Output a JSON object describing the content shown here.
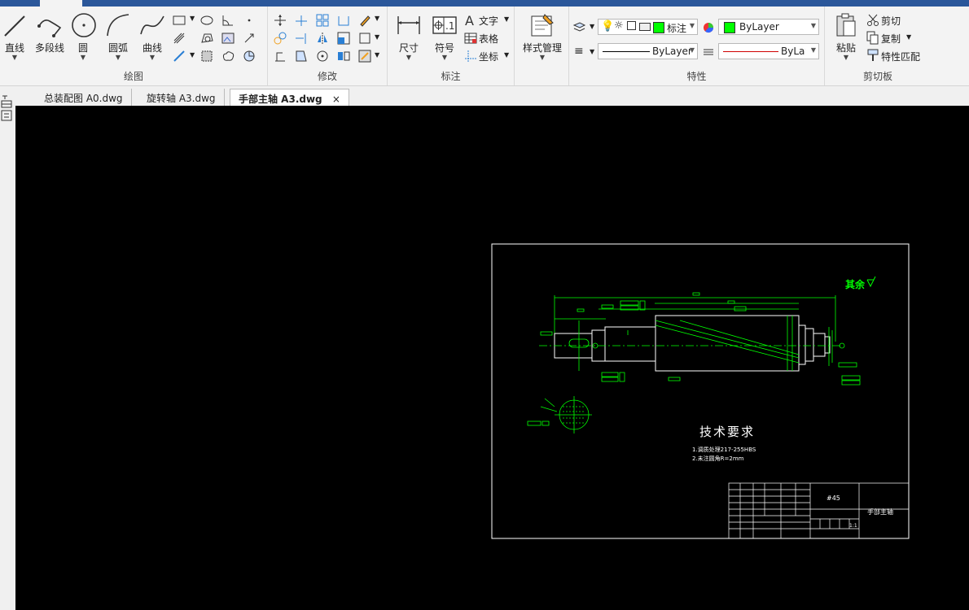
{
  "ribbon": {
    "draw": {
      "label": "绘图",
      "line": "直线",
      "polyline": "多段线",
      "circle": "圆",
      "arc": "圆弧",
      "curve": "曲线"
    },
    "modify": {
      "label": "修改"
    },
    "annotation": {
      "label": "标注",
      "dimension": "尺寸",
      "symbol": "符号",
      "text": "文字",
      "table": "表格",
      "coordinate": "坐标"
    },
    "style": {
      "label": "样式管理"
    },
    "properties": {
      "label": "特性",
      "layer_name": "标注",
      "color": "ByLayer",
      "linetype": "ByLayer",
      "lineweight": "ByLayer",
      "accent_green": "#00ff00",
      "accent_red": "#d00000"
    },
    "clipboard": {
      "label": "剪切板",
      "paste": "粘贴",
      "cut": "剪切",
      "copy": "复制",
      "match": "特性匹配"
    }
  },
  "doc_tabs": [
    {
      "label": "总装配图 A0.dwg"
    },
    {
      "label": "旋转轴 A3.dwg"
    },
    {
      "label": "手部主轴 A3.dwg",
      "active": true
    }
  ],
  "drawing": {
    "surface_note": "其余",
    "tech_title": "技术要求",
    "tech_notes": [
      "1.调质处理217-255HBS",
      "2.未注圆角R=2mm"
    ],
    "material": "#45",
    "part_name": "手部主轴",
    "scale": "1:1"
  }
}
